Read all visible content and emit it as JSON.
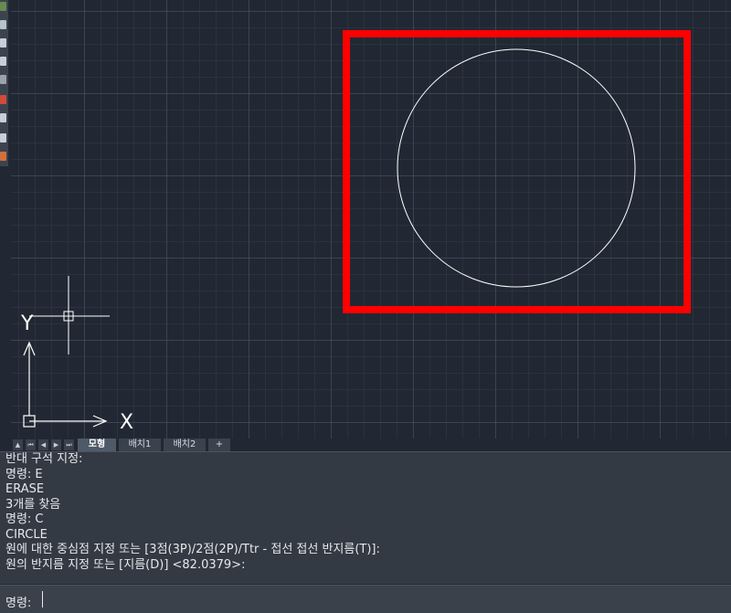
{
  "colors": {
    "canvas_background": "#212833",
    "highlight_box": "#ff0000",
    "circle_stroke": "#ffffff",
    "panel_background": "#333a44"
  },
  "ucs": {
    "x_label": "X",
    "y_label": "Y"
  },
  "tabs": [
    {
      "label": "모형",
      "active": true
    },
    {
      "label": "배치1",
      "active": false
    },
    {
      "label": "배치2",
      "active": false
    },
    {
      "label": "+",
      "active": false
    }
  ],
  "nav_icons": [
    "triangle-up-icon",
    "first-page-icon",
    "previous-page-icon",
    "next-page-icon",
    "last-page-icon"
  ],
  "command_history": [
    "반대 구석 지정:",
    "명령: E",
    "ERASE",
    "3개를 찾음",
    "명령: C",
    "CIRCLE",
    "원에 대한 중심점 지정 또는 [3점(3P)/2점(2P)/Ttr - 접선 접선 반지름(T)]:",
    "원의 반지름 지정 또는 [지름(D)] <82.0379>:"
  ],
  "command_line": {
    "prompt": "명령:",
    "value": ""
  }
}
